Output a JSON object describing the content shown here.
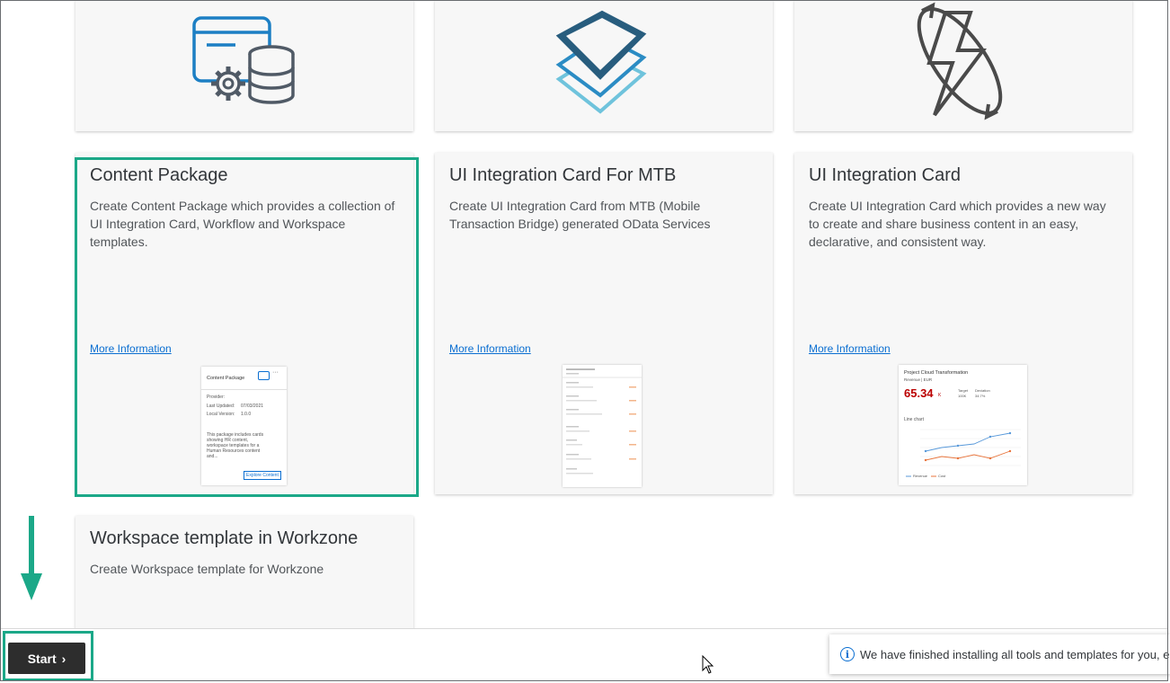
{
  "cards": [
    {
      "title": "Content Package",
      "description": "Create Content Package which provides a collection of UI Integration Card, Workflow and Workspace templates.",
      "more_info": "More Information"
    },
    {
      "title": "UI Integration Card For MTB",
      "description": "Create UI Integration Card from MTB (Mobile Transaction Bridge) generated OData Services",
      "more_info": "More Information"
    },
    {
      "title": "UI Integration Card",
      "description": "Create UI Integration Card which provides a new way to create and share business content in an easy, declarative, and consistent way.",
      "more_info": "More Information"
    },
    {
      "title": "Workspace template in Workzone",
      "description": "Create Workspace template for Workzone"
    }
  ],
  "thumb_content_package": {
    "title": "Content Package",
    "provider_label": "Provider:",
    "updated_label": "Last Updated:",
    "updated_value": "07/03/2021",
    "version_label": "Local Version:",
    "version_value": "1.0.0",
    "body": "This package includes cards showing HR content, workspace templates for a Human Resources content and...",
    "button": "Explore Content"
  },
  "thumb_card": {
    "title": "Project Cloud Transformation",
    "subtitle": "Revenue | EUR",
    "kpi": "65.34",
    "kpi_unit": "K",
    "target_label": "Target",
    "target_value": "100K",
    "deviation_label": "Deviation",
    "deviation_value": "34.7%",
    "chart_title": "Line chart",
    "legend_revenue": "Revenue",
    "legend_cost": "Cost"
  },
  "footer": {
    "start_label": "Start",
    "toast_text": "We have finished installing all tools and templates for you, e"
  },
  "colors": {
    "accent": "#1ba888",
    "link": "#0a6ed1",
    "button": "#2d2d2d"
  }
}
